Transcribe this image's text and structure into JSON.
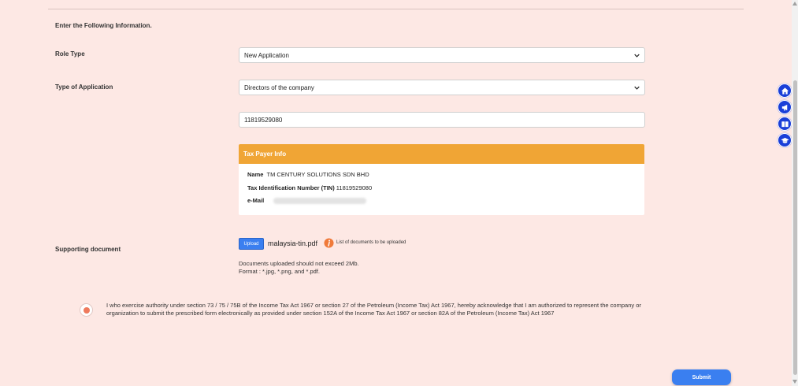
{
  "form": {
    "heading": "Enter the Following Information.",
    "role_type_label": "Role Type",
    "role_type_value": "New Application",
    "application_type_label": "Type of Application",
    "application_type_value": "Directors of the company",
    "id_number_value": "11819529080",
    "taxpayer": {
      "header": "Tax Payer Info",
      "name_label": "Name",
      "name_value": "TM CENTURY SOLUTIONS SDN BHD",
      "tin_label": "Tax Identification Number (TIN)",
      "tin_value": "11819529080",
      "email_label": "e-Mail"
    },
    "supporting_label": "Supporting document",
    "upload_label": "Upload",
    "file_name": "malaysia-tin.pdf",
    "doc_list_label": "List of documents to be uploaded",
    "note_line1": "Documents uploaded should not exceed 2Mb.",
    "note_line2": "Format : *.jpg, *.png, and *.pdf.",
    "acknowledgement": "I who exercise authority under section 73 / 75 / 75B of the Income Tax Act 1967 or section 27 of the Petroleum (Income Tax) Act 1967, hereby acknowledge that I am authorized to represent the company or organization to submit the prescribed form electronically as provided under section 152A of the Income Tax Act 1967 or section 82A of the Petroleum (Income Tax) Act 1967",
    "submit_label": "Submit"
  },
  "side_nav": {
    "icons": [
      "home-icon",
      "megaphone-icon",
      "book-icon",
      "graduation-cap-icon"
    ]
  },
  "colors": {
    "background": "#fde8e4",
    "accent_orange": "#f0a535",
    "primary_blue": "#3a7ff0",
    "side_nav_blue": "#1a3fd8",
    "radio_orange": "#ef7a5d"
  }
}
